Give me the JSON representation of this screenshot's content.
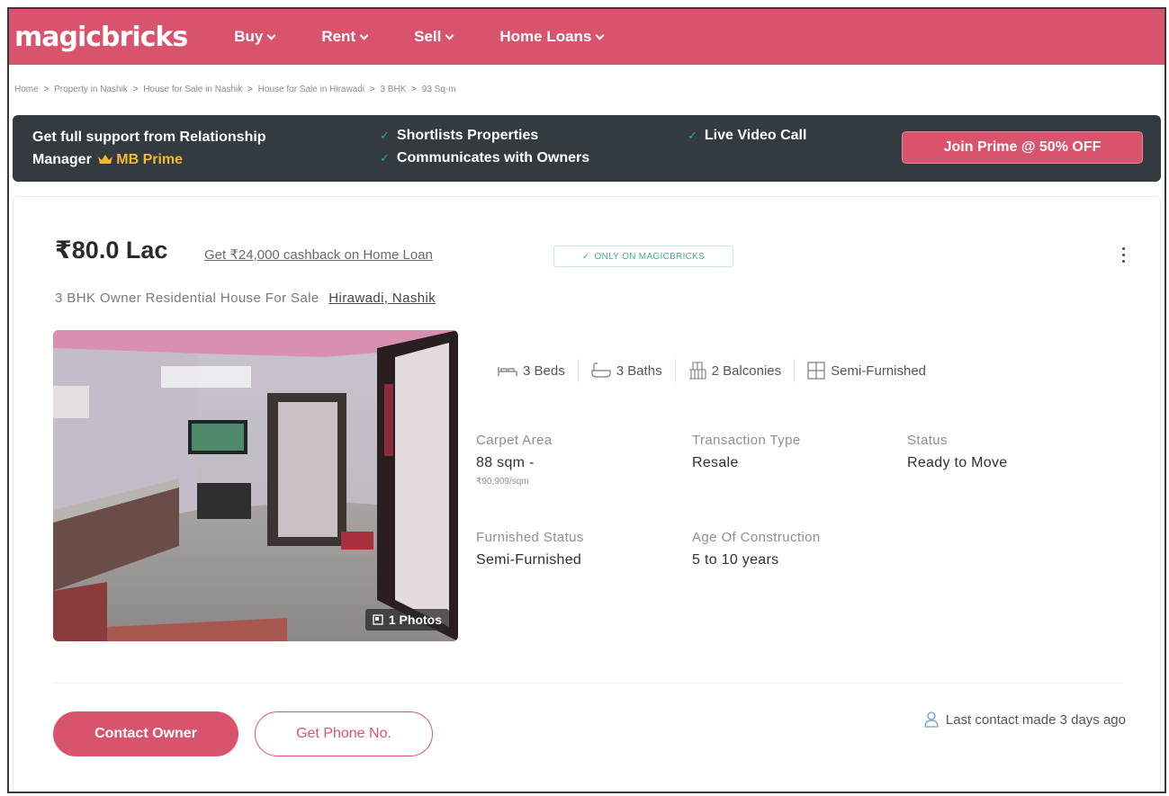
{
  "brand": {
    "logo_text": "magicbricks",
    "primary_color": "#d8536c",
    "banner_color": "#333a40",
    "accent_green": "#1fb58a",
    "prime_gold": "#f3b935"
  },
  "nav": {
    "items": [
      {
        "label": "Buy",
        "icon": "chevron-down-icon"
      },
      {
        "label": "Rent",
        "icon": "chevron-down-icon"
      },
      {
        "label": "Sell",
        "icon": "chevron-down-icon"
      },
      {
        "label": "Home Loans",
        "icon": "chevron-down-icon"
      }
    ]
  },
  "breadcrumb": {
    "separator": ">",
    "items": [
      "Home",
      "Property in Nashik",
      "House for Sale in Nashik",
      "House for Sale in Hirawadi",
      "3 BHK",
      "93 Sq-m"
    ]
  },
  "prime_banner": {
    "title_line1": "Get full support from Relationship",
    "title_line2": "Manager",
    "prime_label": "MB Prime",
    "features": [
      "Shortlists Properties",
      "Communicates with Owners",
      "Live Video Call"
    ],
    "cta_label": "Join Prime @ 50% OFF"
  },
  "listing": {
    "price": "₹80.0 Lac",
    "cashback_link": "Get ₹24,000 cashback on Home Loan",
    "exclusive_badge": "ONLY ON MAGICBRICKS",
    "subtitle": "3 BHK Owner Residential House For Sale",
    "location": "Hirawadi, Nashik",
    "photo_count_label": "1 Photos",
    "amenities": [
      {
        "label": "3 Beds",
        "icon": "bed-icon"
      },
      {
        "label": "3 Baths",
        "icon": "bath-icon"
      },
      {
        "label": "2 Balconies",
        "icon": "balcony-icon"
      },
      {
        "label": "Semi-Furnished",
        "icon": "furnishing-icon"
      }
    ],
    "summary": {
      "carpet_area": {
        "label": "Carpet Area",
        "value": "88 sqm -",
        "sub": "₹90,909/sqm"
      },
      "transaction_type": {
        "label": "Transaction Type",
        "value": "Resale"
      },
      "status": {
        "label": "Status",
        "value": "Ready to Move"
      },
      "furnished_status": {
        "label": "Furnished Status",
        "value": "Semi-Furnished"
      },
      "age_of_construction": {
        "label": "Age Of Construction",
        "value": "5 to 10 years"
      }
    },
    "actions": {
      "contact_owner": "Contact Owner",
      "get_phone": "Get Phone No."
    },
    "last_contact": "Last contact made 3 days ago"
  }
}
